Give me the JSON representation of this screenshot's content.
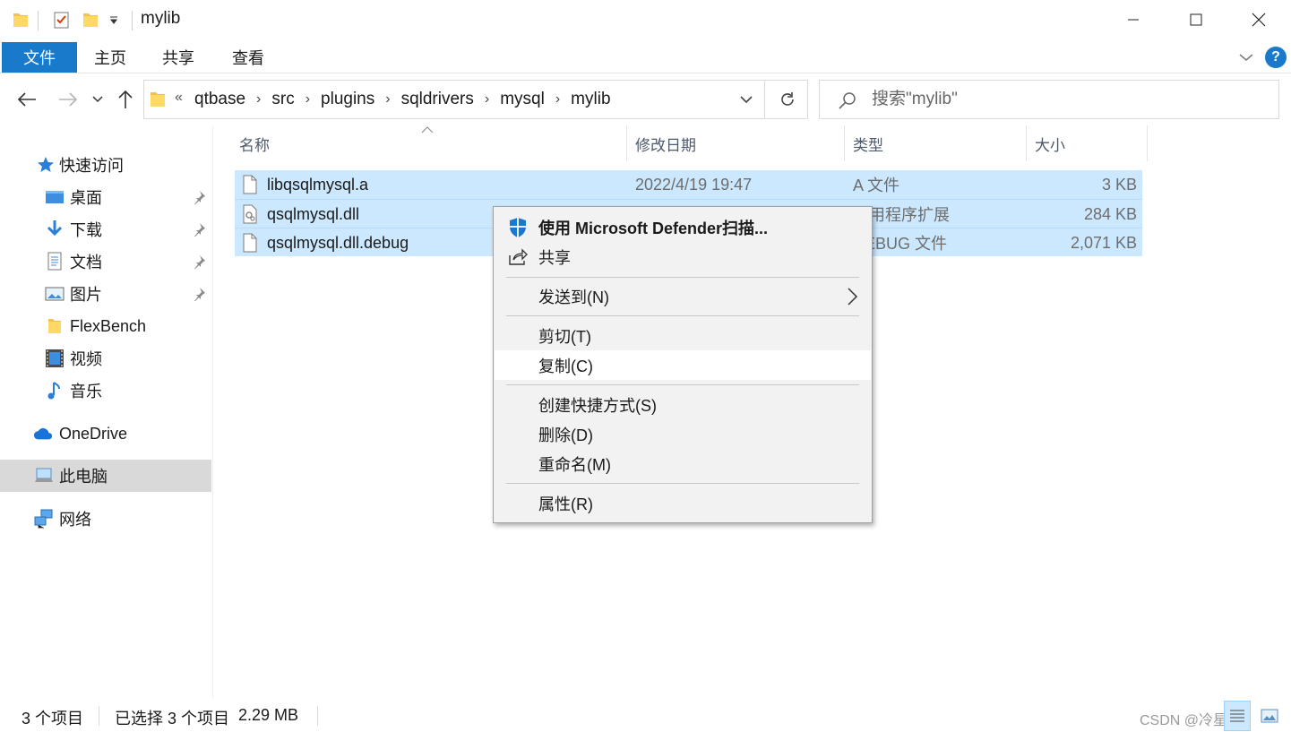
{
  "window": {
    "title": "mylib"
  },
  "ribbon": {
    "tabs": [
      {
        "label": "文件"
      },
      {
        "label": "主页"
      },
      {
        "label": "共享"
      },
      {
        "label": "查看"
      }
    ],
    "help_label": "?"
  },
  "address_bar": {
    "overflow": "«",
    "crumbs": [
      "qtbase",
      "src",
      "plugins",
      "sqldrivers",
      "mysql",
      "mylib"
    ]
  },
  "search": {
    "placeholder": "搜索\"mylib\""
  },
  "sidebar": {
    "items": [
      {
        "label": "快速访问",
        "icon": "star-icon"
      },
      {
        "label": "桌面",
        "icon": "desktop-icon",
        "pinned": true
      },
      {
        "label": "下载",
        "icon": "download-icon",
        "pinned": true
      },
      {
        "label": "文档",
        "icon": "document-icon",
        "pinned": true
      },
      {
        "label": "图片",
        "icon": "picture-icon",
        "pinned": true
      },
      {
        "label": "FlexBench",
        "icon": "folder-icon"
      },
      {
        "label": "视频",
        "icon": "video-icon"
      },
      {
        "label": "音乐",
        "icon": "music-icon"
      },
      {
        "label": "OneDrive",
        "icon": "cloud-icon"
      },
      {
        "label": "此电脑",
        "icon": "computer-icon",
        "selected": true
      },
      {
        "label": "网络",
        "icon": "network-icon"
      }
    ]
  },
  "columns": {
    "name": "名称",
    "modified": "修改日期",
    "type": "类型",
    "size": "大小"
  },
  "files": [
    {
      "name": "libqsqlmysql.a",
      "modified": "2022/4/19 19:47",
      "type": "A 文件",
      "size": "3 KB"
    },
    {
      "name": "qsqlmysql.dll",
      "modified": "",
      "type": "应用程序扩展",
      "size": "284 KB"
    },
    {
      "name": "qsqlmysql.dll.debug",
      "modified": "",
      "type": "DEBUG 文件",
      "size": "2,071 KB"
    }
  ],
  "context_menu": {
    "items": [
      {
        "label": "使用 Microsoft Defender扫描...",
        "icon": "defender-shield-icon"
      },
      {
        "label": "共享",
        "icon": "share-icon"
      },
      {
        "label": "发送到(N)",
        "submenu": true
      },
      {
        "label": "剪切(T)"
      },
      {
        "label": "复制(C)",
        "hovered": true
      },
      {
        "label": "创建快捷方式(S)"
      },
      {
        "label": "删除(D)"
      },
      {
        "label": "重命名(M)"
      },
      {
        "label": "属性(R)"
      }
    ]
  },
  "status_bar": {
    "item_count": "3 个项目",
    "selection": "已选择 3 个项目",
    "selection_size": "2.29 MB",
    "watermark": "CSDN @冷星星"
  },
  "colors": {
    "accent": "#1979ca",
    "selection": "#cce8ff",
    "menu_bg": "#f2f2f2"
  }
}
